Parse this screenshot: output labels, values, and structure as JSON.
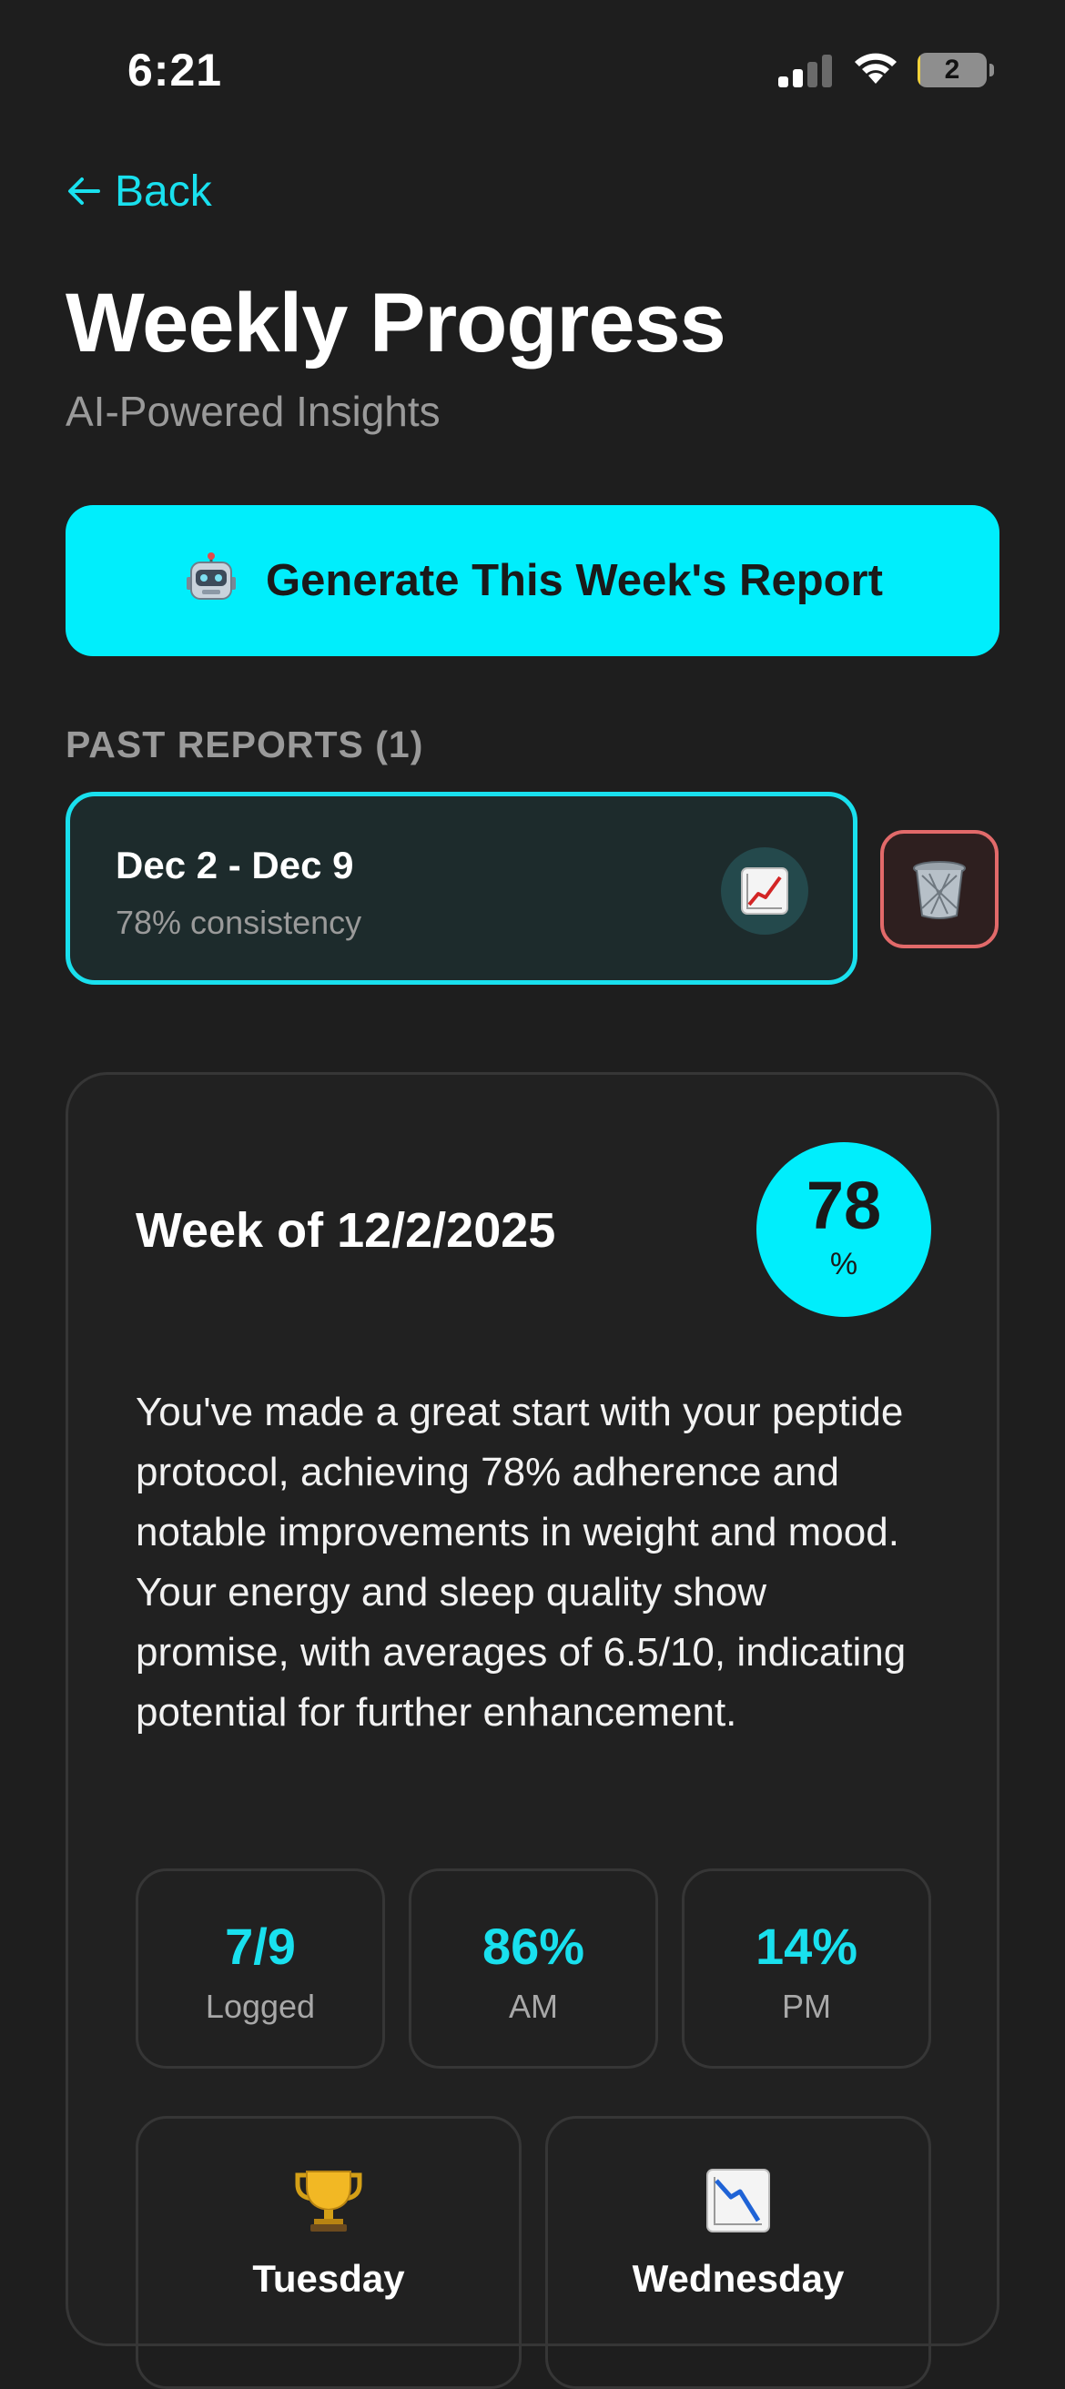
{
  "status_bar": {
    "time": "6:21",
    "battery_level": "2",
    "battery_fraction": 0.02
  },
  "nav": {
    "back_label": "Back"
  },
  "header": {
    "title": "Weekly Progress",
    "subtitle": "AI-Powered Insights"
  },
  "generate_button": {
    "label": "Generate This Week's Report",
    "icon": "robot-icon"
  },
  "past_reports": {
    "section_label": "PAST REPORTS (1)",
    "items": [
      {
        "title": "Dec 2 - Dec 9",
        "subtitle": "78% consistency",
        "icon": "chart-increasing-icon"
      }
    ],
    "delete_icon": "trash-icon"
  },
  "week_report": {
    "title": "Week of 12/2/2025",
    "score": {
      "value": "78",
      "unit": "%"
    },
    "summary": "You've made a great start with your peptide protocol, achieving 78% adherence and notable improvements in weight and mood. Your energy and sleep quality show promise, with averages of 6.5/10, indicating potential for further enhancement.",
    "stats": [
      {
        "value": "7/9",
        "label": "Logged"
      },
      {
        "value": "86%",
        "label": "AM"
      },
      {
        "value": "14%",
        "label": "PM"
      }
    ],
    "days": [
      {
        "label": "Tuesday",
        "icon": "trophy-icon"
      },
      {
        "label": "Wednesday",
        "icon": "chart-decreasing-icon"
      }
    ]
  },
  "colors": {
    "background": "#1e1e1e",
    "accent": "#00eefc",
    "accent_text": "#19e0ee",
    "muted_text": "#9a9a9a",
    "danger_border": "#e26a6a"
  }
}
